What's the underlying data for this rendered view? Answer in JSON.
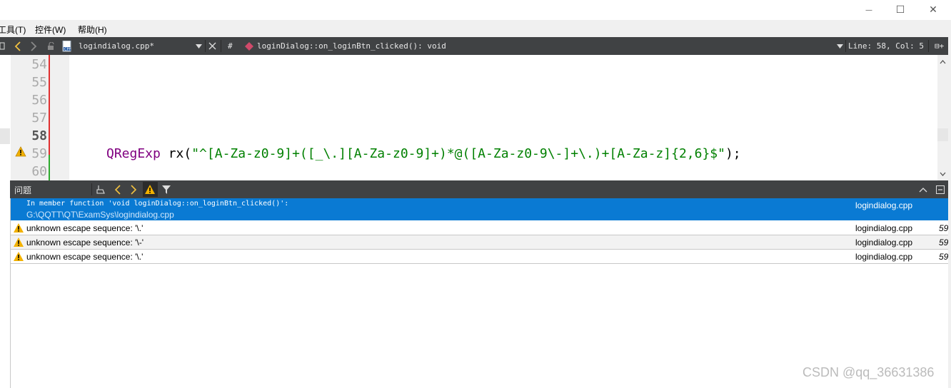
{
  "window": {
    "minimize_glyph": "—",
    "maximize_glyph": "☐",
    "close_glyph": "✕"
  },
  "menu": {
    "items": [
      "工具(T)",
      "控件(W)",
      "帮助(H)"
    ]
  },
  "editor_toolbar": {
    "file_name": "logindialog.cpp*",
    "hash": "#",
    "symbol": "loginDialog::on_loginBtn_clicked(): void",
    "position": "Line: 58, Col: 5",
    "split_glyph": "⊟+"
  },
  "editor": {
    "line_numbers": [
      "54",
      "55",
      "56",
      "57",
      "58",
      "59",
      "60"
    ],
    "current_line": "58",
    "warning_line": "59",
    "code_line_59": {
      "type": "QRegExp",
      "ident": " rx(",
      "string": "\"^[A-Za-z0-9]+([_\\.][A-Za-z0-9]+)*@([A-Za-z0-9\\-]+\\.)+[A-Za-z]{2,6}$\"",
      "end": ");"
    }
  },
  "issues_panel": {
    "title": "问题",
    "selected": {
      "message": "In member function 'void loginDialog::on_loginBtn_clicked()':",
      "path": "G:\\QQTT\\QT\\ExamSys\\logindialog.cpp",
      "file": "logindialog.cpp"
    },
    "rows": [
      {
        "message": "unknown escape sequence: '\\.'",
        "file": "logindialog.cpp",
        "line": "59"
      },
      {
        "message": "unknown escape sequence: '\\-'",
        "file": "logindialog.cpp",
        "line": "59"
      },
      {
        "message": "unknown escape sequence: '\\.'",
        "file": "logindialog.cpp",
        "line": "59"
      }
    ]
  },
  "watermark": "CSDN @qq_36631386",
  "colors": {
    "toolbar_bg": "#404244",
    "selection": "#0a7ad3",
    "warning": "#f2b100",
    "keyword": "#800080",
    "string": "#008000"
  }
}
